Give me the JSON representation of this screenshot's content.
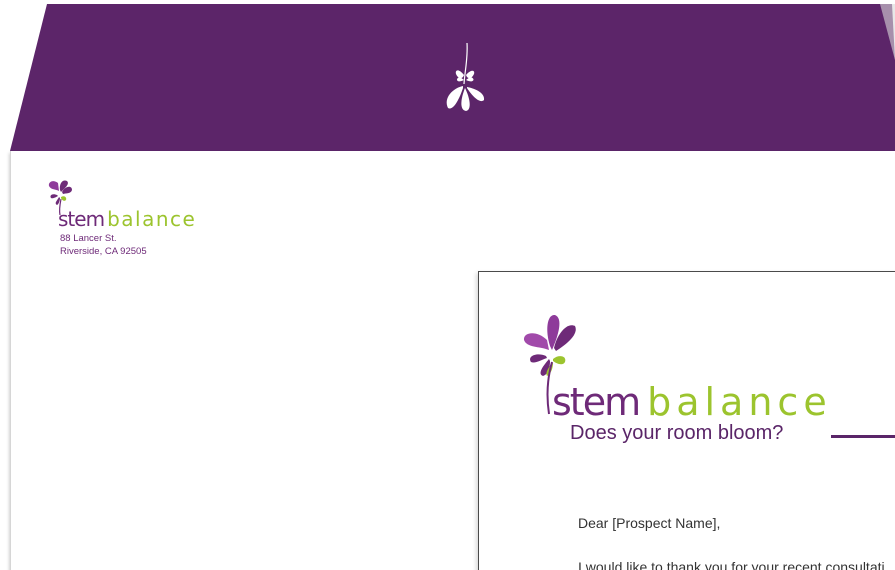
{
  "brand": {
    "name_part1": "stem",
    "name_part2": "balance",
    "primary_color": "#5c2569",
    "accent_color": "#9cc42e",
    "petal_color": "#8e3b9a"
  },
  "envelope": {
    "address_line1": "88 Lancer St.",
    "address_line2": "Riverside, CA 92505"
  },
  "letter": {
    "tagline": "Does your room bloom?",
    "salutation": "Dear [Prospect Name],",
    "body_first_line": "I would like to thank you for your recent consultati"
  },
  "icons": [
    "flower-icon-white",
    "flower-logo-small",
    "flower-logo-large"
  ]
}
